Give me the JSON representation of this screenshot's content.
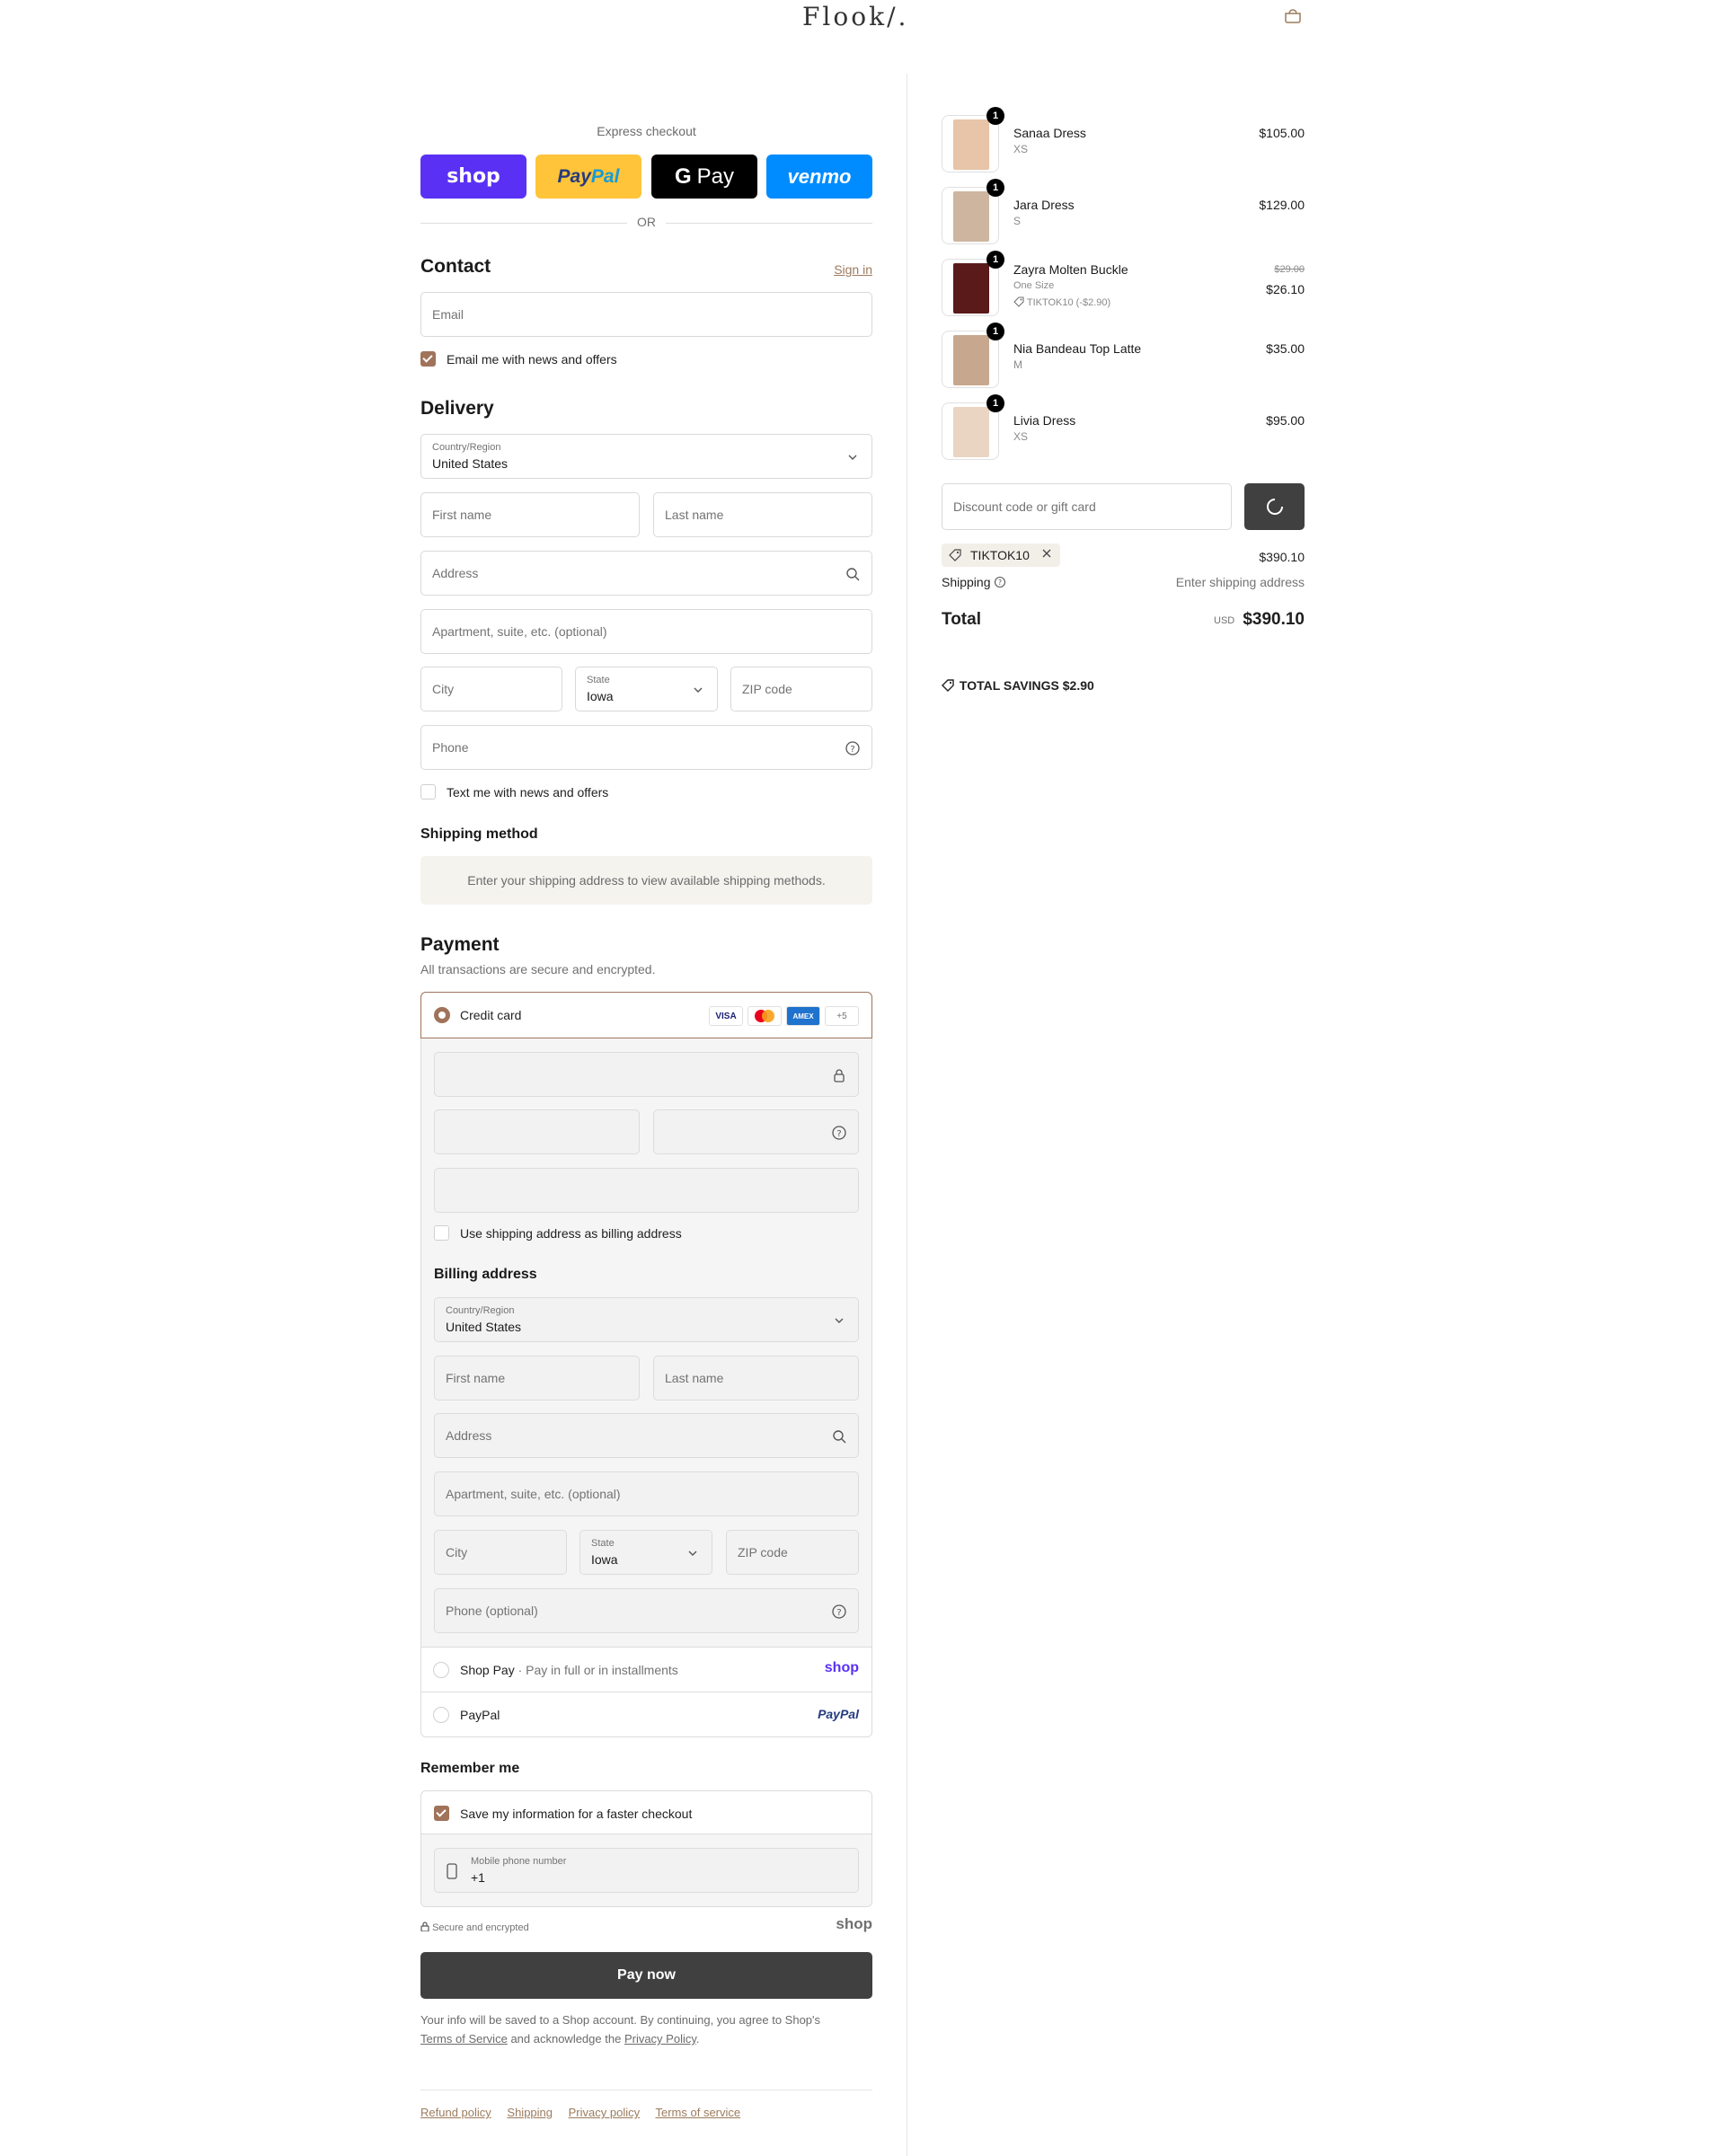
{
  "header": {
    "logo": "Flook/.",
    "cart_icon": "bag-icon"
  },
  "express": {
    "title": "Express checkout",
    "buttons": {
      "shop": "shop",
      "paypal_a": "Pay",
      "paypal_b": "Pal",
      "gpay": "Pay",
      "venmo": "venmo"
    },
    "or": "OR"
  },
  "contact": {
    "title": "Contact",
    "sign_in": "Sign in",
    "email_placeholder": "Email",
    "news_label": "Email me with news and offers"
  },
  "delivery": {
    "title": "Delivery",
    "country_label": "Country/Region",
    "country_value": "United States",
    "first_name": "First name",
    "last_name": "Last name",
    "address": "Address",
    "apartment": "Apartment, suite, etc. (optional)",
    "city": "City",
    "state_label": "State",
    "state_value": "Iowa",
    "zip": "ZIP code",
    "phone": "Phone",
    "text_label": "Text me with news and offers"
  },
  "shipping_method": {
    "title": "Shipping method",
    "message": "Enter your shipping address to view available shipping methods."
  },
  "payment": {
    "title": "Payment",
    "subtitle": "All transactions are secure and encrypted.",
    "credit_card": "Credit card",
    "brands": {
      "visa": "VISA",
      "amex": "AMEX",
      "more": "+5"
    },
    "use_shipping": "Use shipping address as billing address",
    "billing_title": "Billing address",
    "billing": {
      "country_label": "Country/Region",
      "country_value": "United States",
      "first_name": "First name",
      "last_name": "Last name",
      "address": "Address",
      "apartment": "Apartment, suite, etc. (optional)",
      "city": "City",
      "state_label": "State",
      "state_value": "Iowa",
      "zip": "ZIP code",
      "phone": "Phone (optional)"
    },
    "shop_pay": "Shop Pay",
    "shop_pay_dot": "·",
    "shop_pay_sub": "Pay in full or in installments",
    "shop_logo": "shop",
    "paypal": "PayPal",
    "paypal_logo": "PayPal"
  },
  "remember": {
    "title": "Remember me",
    "save_label": "Save my information for a faster checkout",
    "mobile_label": "Mobile phone number",
    "mobile_value": "+1"
  },
  "secure": {
    "text": "Secure and encrypted",
    "shop_logo": "shop"
  },
  "pay_now": "Pay now",
  "legal": {
    "text1": "Your info will be saved to a Shop account. By continuing, you agree to Shop's",
    "tos": "Terms of Service",
    "text2": "and acknowledge the",
    "privacy": "Privacy Policy",
    "text3": "."
  },
  "footer": {
    "links": [
      "Refund policy",
      "Shipping",
      "Privacy policy",
      "Terms of service"
    ]
  },
  "cart": {
    "items": [
      {
        "name": "Sanaa Dress",
        "variant": "XS",
        "price": "$105.00",
        "qty": "1",
        "color": "#e8c4a8"
      },
      {
        "name": "Jara Dress",
        "variant": "S",
        "price": "$129.00",
        "qty": "1",
        "color": "#cdb5a0"
      },
      {
        "name": "Zayra Molten Buckle",
        "variant": "One Size",
        "price": "$26.10",
        "original_price": "$29.00",
        "discount": "TIKTOK10 (-$2.90)",
        "qty": "1",
        "color": "#5a1a1a"
      },
      {
        "name": "Nia Bandeau Top Latte",
        "variant": "M",
        "price": "$35.00",
        "qty": "1",
        "color": "#c7a88e"
      },
      {
        "name": "Livia Dress",
        "variant": "XS",
        "price": "$95.00",
        "qty": "1",
        "color": "#ead5c2"
      }
    ],
    "discount_placeholder": "Discount code or gift card",
    "code": "TIKTOK10",
    "subtotal": "$390.10",
    "shipping_label": "Shipping",
    "shipping_value": "Enter shipping address",
    "total_label": "Total",
    "currency": "USD",
    "total": "$390.10",
    "savings_label": "TOTAL SAVINGS",
    "savings_value": "$2.90"
  },
  "colors": {
    "accent": "#a0735a",
    "button": "#404040",
    "shop_purple": "#5a31f4"
  }
}
